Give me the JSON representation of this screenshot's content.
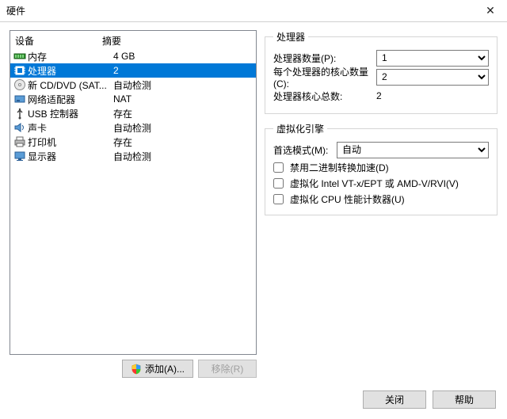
{
  "window": {
    "title": "硬件"
  },
  "device_list": {
    "headers": {
      "device": "设备",
      "summary": "摘要"
    },
    "rows": [
      {
        "icon": "memory-icon",
        "name": "内存",
        "summary": "4 GB",
        "selected": false
      },
      {
        "icon": "cpu-icon",
        "name": "处理器",
        "summary": "2",
        "selected": true
      },
      {
        "icon": "cd-icon",
        "name": "新 CD/DVD (SAT...",
        "summary": "自动检测",
        "selected": false
      },
      {
        "icon": "nic-icon",
        "name": "网络适配器",
        "summary": "NAT",
        "selected": false
      },
      {
        "icon": "usb-icon",
        "name": "USB 控制器",
        "summary": "存在",
        "selected": false
      },
      {
        "icon": "sound-icon",
        "name": "声卡",
        "summary": "自动检测",
        "selected": false
      },
      {
        "icon": "printer-icon",
        "name": "打印机",
        "summary": "存在",
        "selected": false
      },
      {
        "icon": "display-icon",
        "name": "显示器",
        "summary": "自动检测",
        "selected": false
      }
    ]
  },
  "left_buttons": {
    "add": "添加(A)...",
    "remove": "移除(R)"
  },
  "processor_group": {
    "title": "处理器",
    "count_label": "处理器数量(P):",
    "count_value": "1",
    "cores_label": "每个处理器的核心数量(C):",
    "cores_value": "2",
    "total_label": "处理器核心总数:",
    "total_value": "2"
  },
  "virt_group": {
    "title": "虚拟化引擎",
    "mode_label": "首选模式(M):",
    "mode_value": "自动",
    "cb1": "禁用二进制转换加速(D)",
    "cb2": "虚拟化 Intel VT-x/EPT 或 AMD-V/RVI(V)",
    "cb3": "虚拟化 CPU 性能计数器(U)"
  },
  "footer": {
    "close": "关闭",
    "help": "帮助"
  }
}
